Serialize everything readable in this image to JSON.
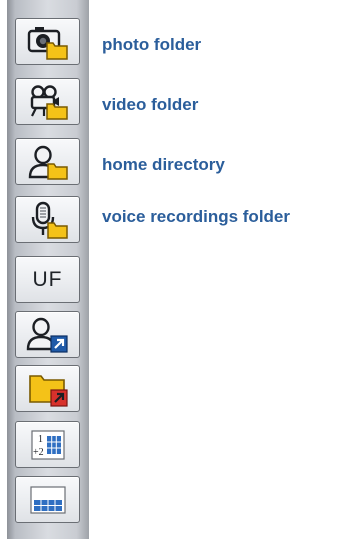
{
  "toolbar": {
    "buttons": [
      {
        "icon": "photo-folder-icon",
        "label": "photo folder"
      },
      {
        "icon": "video-folder-icon",
        "label": "video folder"
      },
      {
        "icon": "home-directory-icon",
        "label": "home directory"
      },
      {
        "icon": "voice-recordings-folder-icon",
        "label": "voice recordings folder"
      },
      {
        "icon": "uf-icon",
        "text": "UF"
      },
      {
        "icon": "user-shortcut-icon"
      },
      {
        "icon": "folder-shortcut-icon"
      },
      {
        "icon": "numbered-grid-icon",
        "text_top": "1",
        "text_bottom": "+2"
      },
      {
        "icon": "grid-table-icon"
      }
    ]
  },
  "colors": {
    "label_text": "#2b5e9b",
    "folder_yellow": "#f4c218",
    "shortcut_blue": "#1f5aa8",
    "shortcut_red": "#d8312c",
    "grid_blue": "#2f6fc2"
  }
}
